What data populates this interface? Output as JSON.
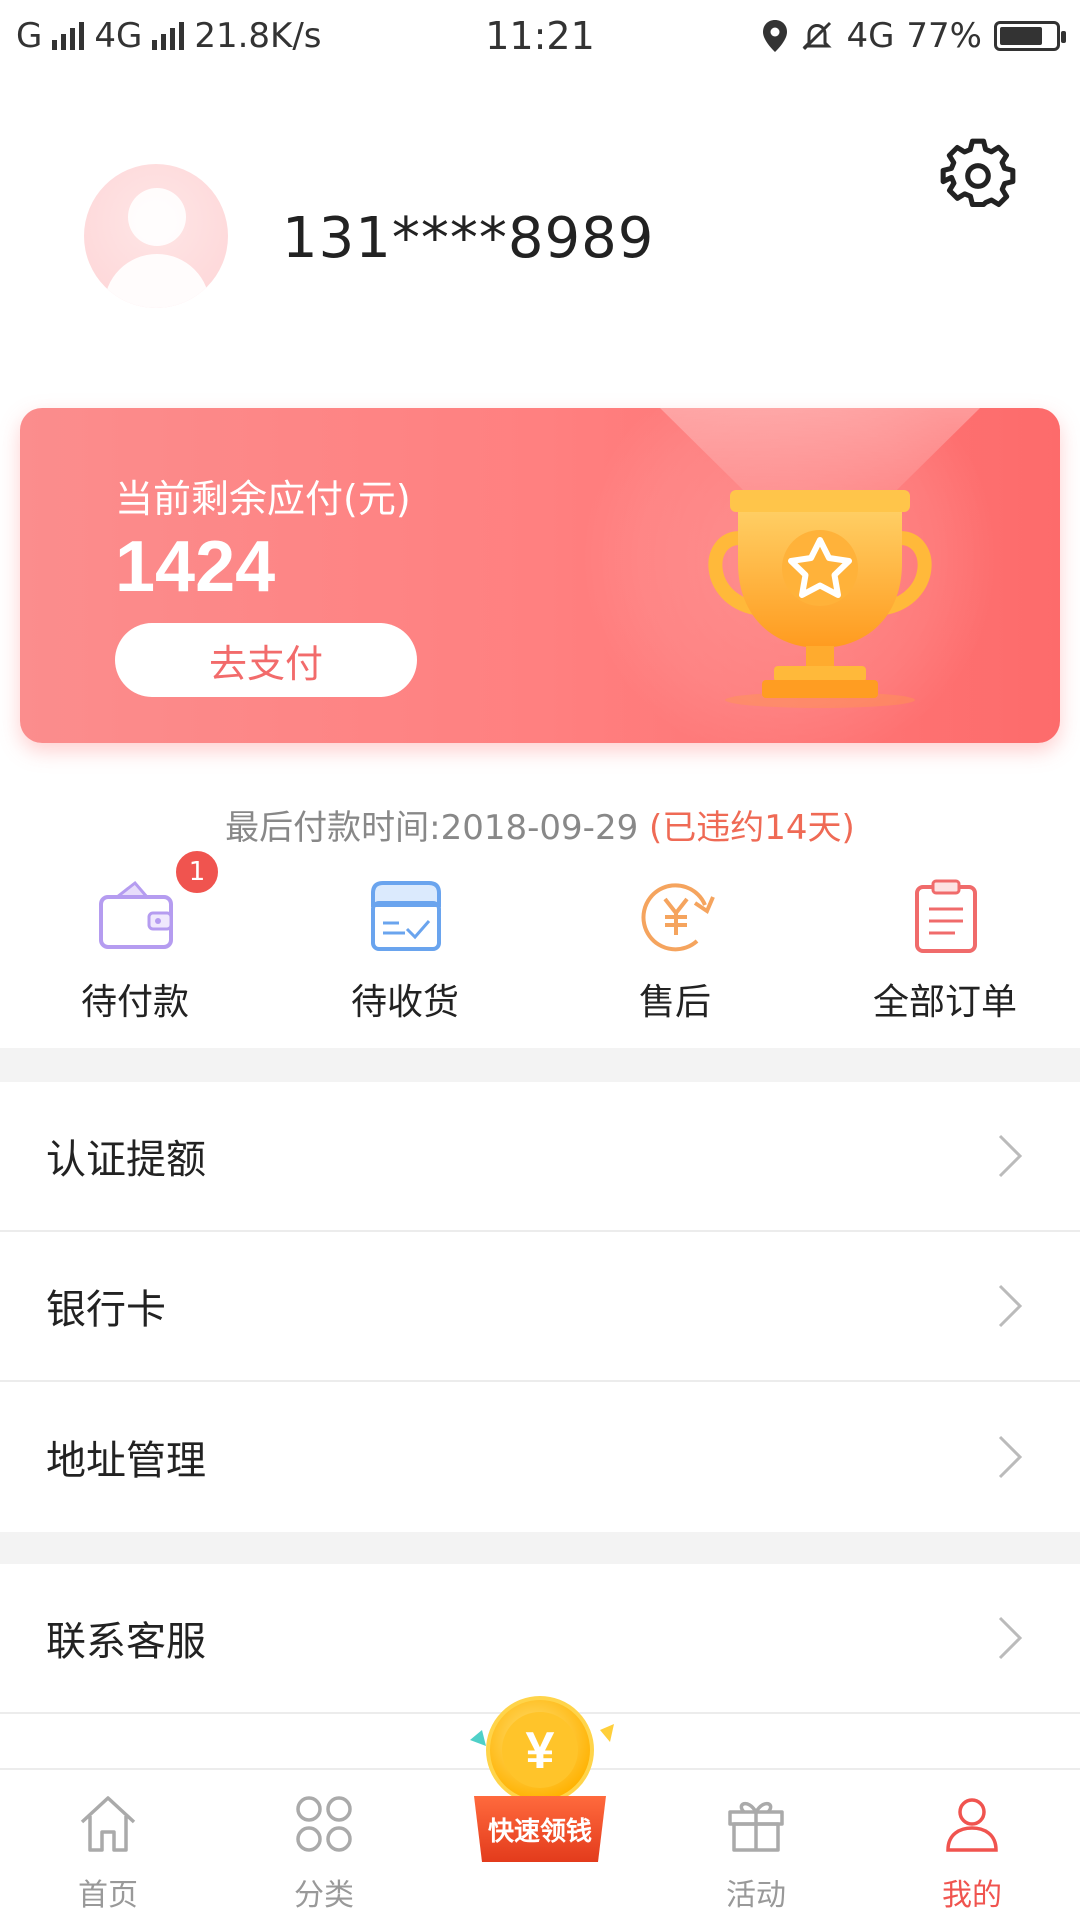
{
  "status_bar": {
    "left_text": "G",
    "network": "4G",
    "speed": "21.8K/s",
    "time": "11:21",
    "net_right": "4G",
    "battery": "77%",
    "battery_level": 0.77
  },
  "profile": {
    "phone": "131****8989",
    "avatar_icon": "avatar-icon",
    "settings_icon": "gear-icon"
  },
  "balance_card": {
    "label": "当前剩余应付(元)",
    "amount": "1424",
    "pay_button": "去支付",
    "illustration": "trophy-icon"
  },
  "due": {
    "text": "最后付款时间:2018-09-29 ",
    "overdue": "(已违约14天)"
  },
  "orders": [
    {
      "label": "待付款",
      "icon": "wallet-icon",
      "badge": "1"
    },
    {
      "label": "待收货",
      "icon": "delivery-box-icon"
    },
    {
      "label": "售后",
      "icon": "yuan-refresh-icon"
    },
    {
      "label": "全部订单",
      "icon": "clipboard-icon"
    }
  ],
  "menu": [
    {
      "label": "认证提额"
    },
    {
      "label": "银行卡"
    },
    {
      "label": "地址管理"
    },
    {
      "label": "联系客服"
    }
  ],
  "tabbar": {
    "tabs": [
      {
        "label": "首页",
        "icon": "home-icon"
      },
      {
        "label": "分类",
        "icon": "category-icon"
      },
      {
        "label": "活动",
        "icon": "gift-icon"
      },
      {
        "label": "我的",
        "icon": "person-icon",
        "active": true
      }
    ],
    "promo_label": "快速领钱",
    "promo_symbol": "¥"
  },
  "colors": {
    "accent": "#f0544f",
    "card_start": "#fb8d8d",
    "card_end": "#fd6b6b",
    "overdue": "#ef6a55"
  }
}
